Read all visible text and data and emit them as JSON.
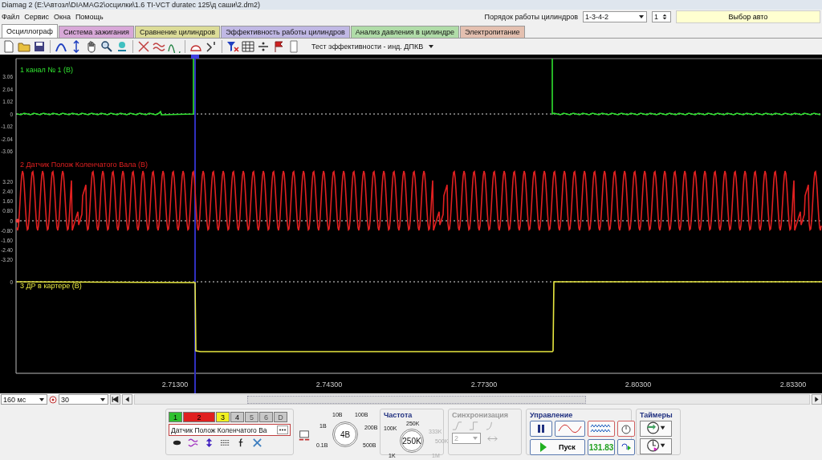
{
  "window": {
    "title": "Diamag 2 (E:\\Автозл\\DIAMAG2\\осцилки\\1.6 TI-VCT duratec 125\\д саши\\2.dm2)"
  },
  "menu": [
    "Файл",
    "Сервис",
    "Окна",
    "Помощь"
  ],
  "cylinder_order": {
    "label": "Порядок работы цилиндров",
    "value": "1-3-4-2",
    "spinner": "1"
  },
  "car_button": "Выбор авто",
  "tabs": [
    {
      "label": "Осциллограф",
      "selected": true,
      "color": "#ffffff"
    },
    {
      "label": "Система зажигания",
      "selected": false,
      "color": "#d8a8d8"
    },
    {
      "label": "Сравнение цилиндров",
      "selected": false,
      "color": "#dcdc98"
    },
    {
      "label": "Эффективность работы цилиндров",
      "selected": false,
      "color": "#c0b8e4"
    },
    {
      "label": "Анализ давления в цилиндре",
      "selected": false,
      "color": "#b0dca8"
    },
    {
      "label": "Электропитание",
      "selected": false,
      "color": "#e4c0b0"
    }
  ],
  "test_dropdown": "Тест эффективности - инд. ДПКВ",
  "channels": [
    {
      "name": "1 канал № 1 (В)",
      "color": "#30e030",
      "ticks": [
        "3.06",
        "2.04",
        "1.02",
        "0",
        "-1.02",
        "-2.04",
        "-3.06"
      ]
    },
    {
      "name": "2 Датчик Полож Коленчатого Вала (В)",
      "color": "#e02020",
      "ticks": [
        "3.20",
        "2.40",
        "1.60",
        "0.80",
        "0",
        "-0.80",
        "-1.60",
        "-2.40",
        "-3.20"
      ]
    },
    {
      "name": "3 ДР в картере (В)",
      "color": "#e8e840",
      "ticks": [
        "0"
      ]
    }
  ],
  "time_ticks": [
    "2.71300",
    "2.74300",
    "2.77300",
    "2.80300",
    "2.83300"
  ],
  "timebase": "160 мс",
  "points": "30",
  "channel_buttons": [
    {
      "label": "1",
      "color": "#30c030",
      "enabled": true,
      "selected": false
    },
    {
      "label": "2",
      "color": "#e02020",
      "enabled": true,
      "selected": true
    },
    {
      "label": "3",
      "color": "#f0f020",
      "enabled": true,
      "selected": false
    },
    {
      "label": "4",
      "color": "#c8c8c8",
      "enabled": true,
      "selected": false
    },
    {
      "label": "5",
      "color": "#c8c8c8",
      "enabled": false,
      "selected": false
    },
    {
      "label": "6",
      "color": "#c8c8c8",
      "enabled": false,
      "selected": false
    },
    {
      "label": "D",
      "color": "#c8c8c8",
      "enabled": false,
      "selected": false
    }
  ],
  "channel_name": "Датчик Полож Коленчатого Ва",
  "voltage_knob": {
    "value": "4В",
    "labels": [
      "10В",
      "100В",
      "1В",
      "200В",
      "0.1В",
      "500В"
    ]
  },
  "frequency": {
    "title": "Частота",
    "value": "250K",
    "labels": [
      {
        "text": "100K",
        "disabled": false
      },
      {
        "text": "250K",
        "disabled": false
      },
      {
        "text": "333K",
        "disabled": true
      },
      {
        "text": "500K",
        "disabled": true
      },
      {
        "text": "1K",
        "disabled": false
      },
      {
        "text": "1M",
        "disabled": true
      }
    ]
  },
  "sync": {
    "title": "Синхронизация",
    "value": "2",
    "disabled": true
  },
  "control": {
    "title": "Управление",
    "start": "Пуск",
    "reading": "131.83"
  },
  "timers": {
    "title": "Таймеры"
  }
}
